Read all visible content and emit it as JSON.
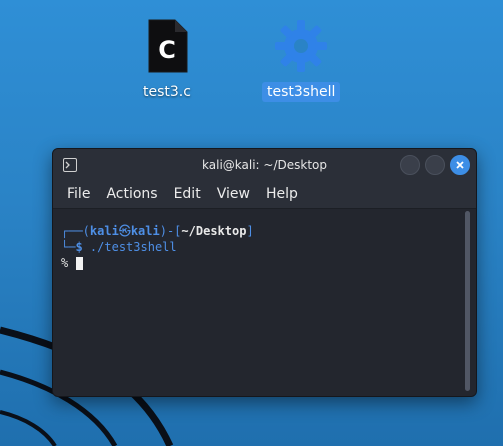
{
  "desktop": {
    "icons": [
      {
        "name": "test3.c",
        "glyph": "C",
        "type": "c-source-file-icon"
      },
      {
        "name": "test3shell",
        "type": "executable-gear-icon",
        "selected": true
      }
    ]
  },
  "window": {
    "title": "kali@kali: ~/Desktop",
    "buttons": [
      "minimize",
      "maximize",
      "close"
    ]
  },
  "menu": [
    "File",
    "Actions",
    "Edit",
    "View",
    "Help"
  ],
  "terminal": {
    "prompt_open": "┌──(",
    "user": "kali",
    "skull": "㉿",
    "host": "kali",
    "prompt_mid": ")-[",
    "path": "~/Desktop",
    "prompt_close": "]",
    "line2_prefix": "└─",
    "dollar": "$",
    "command": "./test3shell",
    "output_prompt": "%"
  },
  "colors": {
    "desktop": "#2a83c6",
    "selection": "#3d8ee6",
    "terminal_bg": "#23262e",
    "prompt_blue": "#4e8fe6"
  }
}
